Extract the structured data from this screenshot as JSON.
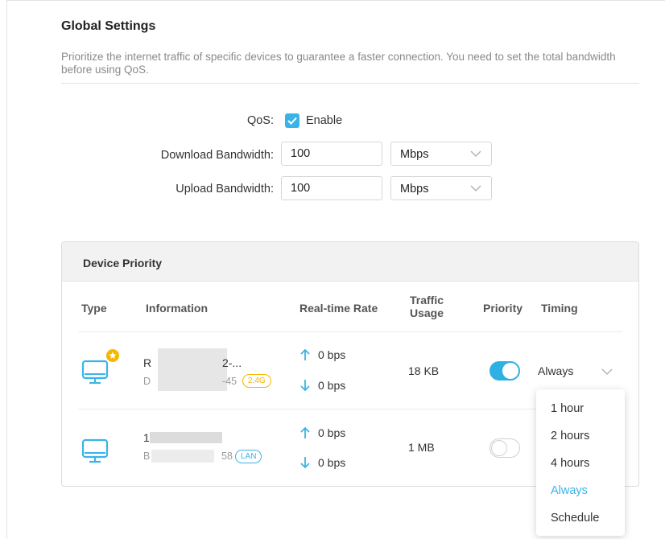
{
  "global": {
    "title": "Global Settings",
    "description": "Prioritize the internet traffic of specific devices to guarantee a faster connection. You need to set the total bandwidth before using QoS."
  },
  "qos": {
    "label": "QoS:",
    "enable_label": "Enable",
    "enabled": true,
    "download_label": "Download Bandwidth:",
    "download_value": "100",
    "download_unit": "Mbps",
    "upload_label": "Upload Bandwidth:",
    "upload_value": "100",
    "upload_unit": "Mbps"
  },
  "device_priority": {
    "title": "Device Priority",
    "columns": {
      "type": "Type",
      "information": "Information",
      "rate": "Real-time Rate",
      "traffic": "Traffic Usage",
      "priority": "Priority",
      "timing": "Timing"
    },
    "devices": [
      {
        "name": "R",
        "name_suffix": "2-...",
        "mac_prefix": "D",
        "mac_suffix": "-45",
        "band": "2.4G",
        "up_rate": "0 bps",
        "down_rate": "0 bps",
        "traffic": "18 KB",
        "priority": true,
        "timing": "Always",
        "icon": "desktop-monitor-icon",
        "starred": true
      },
      {
        "name": "1",
        "name_suffix": "",
        "mac_prefix": "B",
        "mac_suffix": "58",
        "band": "LAN",
        "up_rate": "0 bps",
        "down_rate": "0 bps",
        "traffic": "1 MB",
        "priority": false,
        "icon": "desktop-monitor-icon",
        "starred": false
      }
    ]
  },
  "timing_menu": {
    "options": [
      "1 hour",
      "2 hours",
      "4 hours",
      "Always",
      "Schedule"
    ],
    "selected": "Always"
  },
  "colors": {
    "accent": "#3ab4e8",
    "toggle_on": "#2fb0e3",
    "badge_24g": "#f5b700",
    "star": "#f5b700"
  }
}
